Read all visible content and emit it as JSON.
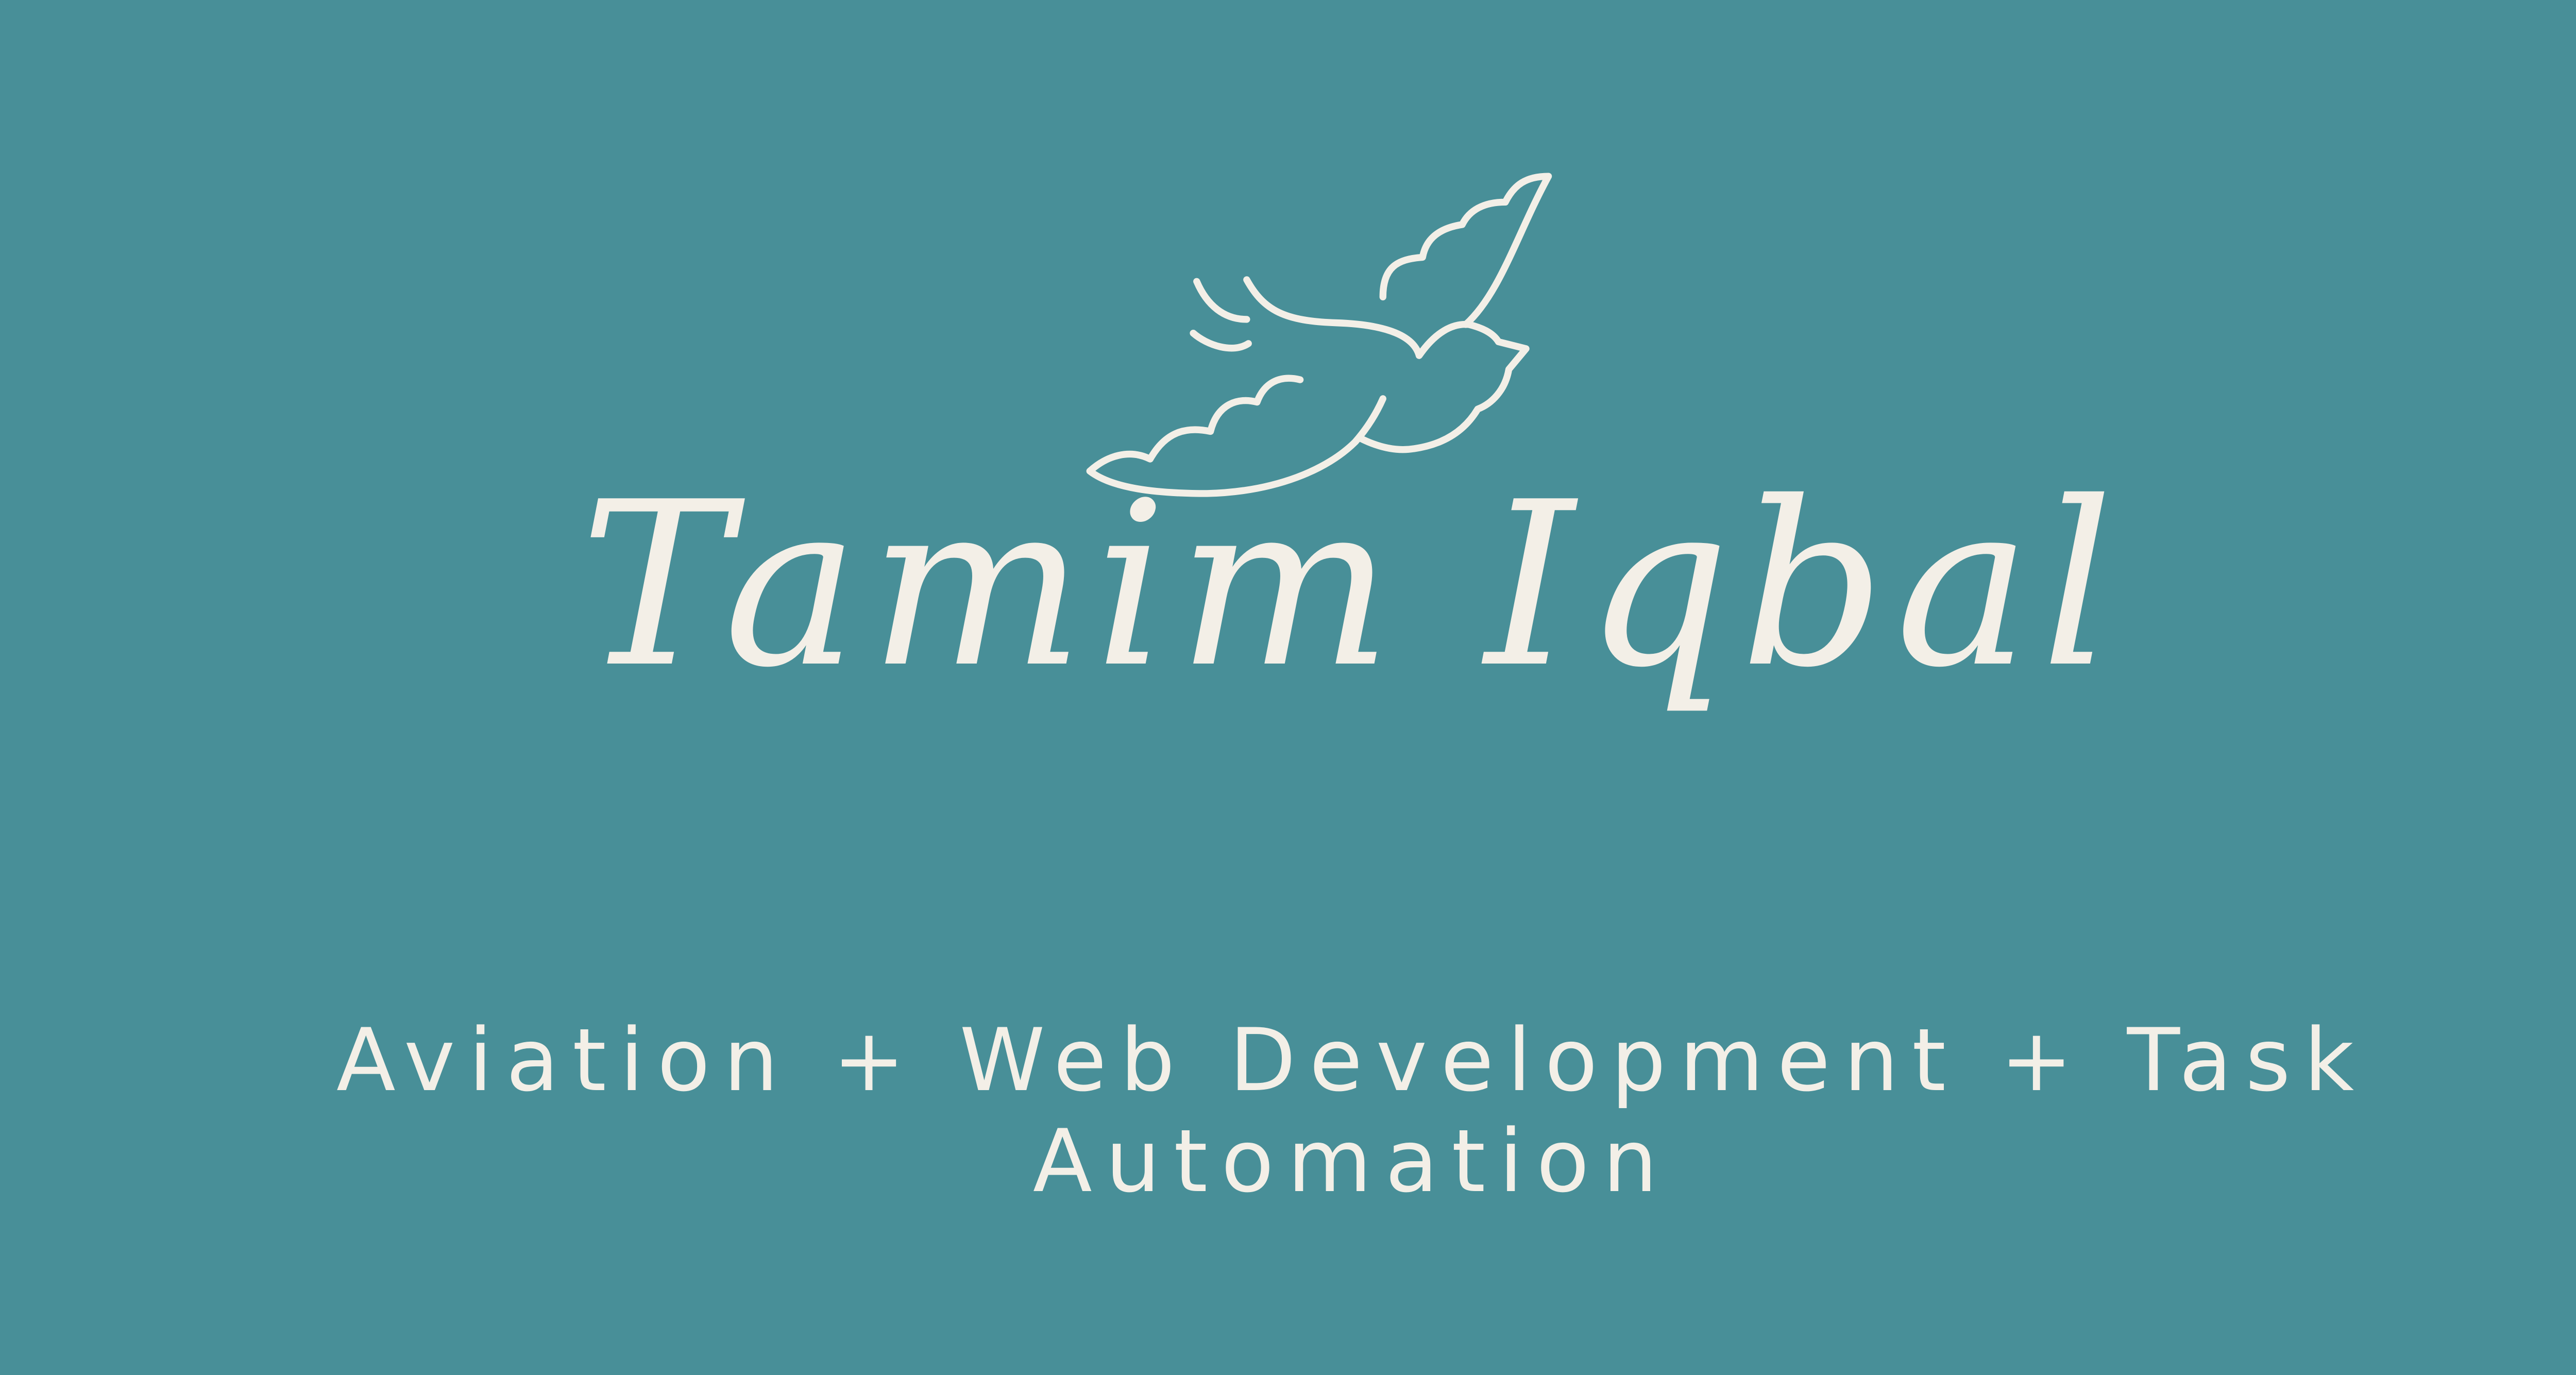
{
  "brand": {
    "name": "Tamim Iqbal",
    "tagline": "Aviation + Web Development + Task Automation",
    "logo_icon": "bird-icon"
  },
  "colors": {
    "background": "#488f98",
    "foreground": "#f3efe7"
  }
}
